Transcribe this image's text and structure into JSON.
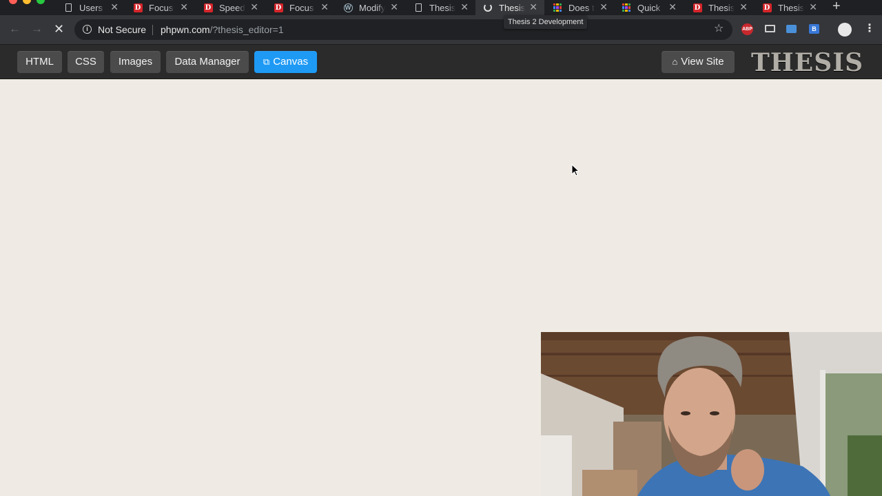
{
  "browser": {
    "tabs": [
      {
        "label": "Users",
        "icon": "document-icon"
      },
      {
        "label": "Focus",
        "icon": "d-badge-icon"
      },
      {
        "label": "Speed",
        "icon": "d-badge-icon"
      },
      {
        "label": "Focus",
        "icon": "d-badge-icon"
      },
      {
        "label": "Modify",
        "icon": "wordpress-icon"
      },
      {
        "label": "Thesis",
        "icon": "document-icon"
      },
      {
        "label": "Thesis",
        "icon": "loading-spinner-icon",
        "active": true
      },
      {
        "label": "Does t",
        "icon": "grid-app-icon"
      },
      {
        "label": "Quick",
        "icon": "grid-app-icon"
      },
      {
        "label": "Thesis",
        "icon": "d-badge-icon"
      },
      {
        "label": "Thesis",
        "icon": "d-badge-icon"
      }
    ],
    "tooltip": "Thesis 2 Development",
    "security_label": "Not Secure",
    "url_host": "phpwn.com",
    "url_rest": "/?thesis_editor=1",
    "extensions": [
      "abp-icon",
      "monitor-icon",
      "camera-icon",
      "blue-extension-icon"
    ]
  },
  "admin_bar": {
    "buttons": [
      {
        "label": "HTML"
      },
      {
        "label": "CSS"
      },
      {
        "label": "Images"
      },
      {
        "label": "Data Manager"
      },
      {
        "label": "Canvas",
        "icon": "external-window-icon",
        "active": true
      }
    ],
    "view_site": {
      "label": "View Site",
      "icon": "home-icon"
    },
    "logo": "THESIS"
  },
  "colors": {
    "accent": "#1e9af5",
    "admin_bar_bg": "#2b2b2b",
    "canvas_bg": "#efebe4"
  }
}
